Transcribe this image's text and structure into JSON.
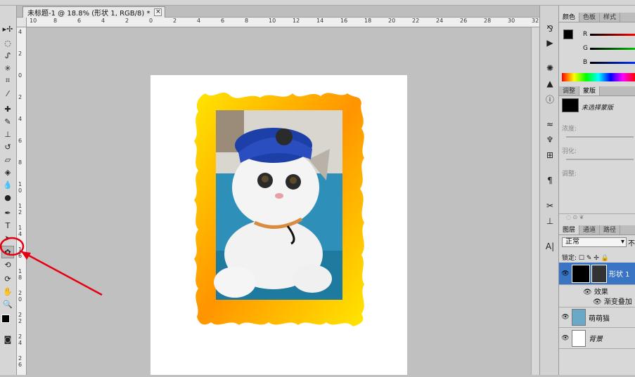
{
  "document": {
    "tab_title": "未标题-1 @ 18.8% (形状 1, RGB/8) *",
    "close_glyph": "×"
  },
  "rulers": {
    "h_ticks": [
      "10",
      "8",
      "6",
      "4",
      "2",
      "0",
      "2",
      "4",
      "6",
      "8",
      "10",
      "12",
      "14",
      "16",
      "18",
      "20",
      "22",
      "24",
      "26",
      "28",
      "30",
      "32"
    ],
    "v_ticks": [
      "4",
      "2",
      "0",
      "2",
      "4",
      "6",
      "8",
      "1 0",
      "1 2",
      "1 4",
      "1 6",
      "1 8",
      "2 0",
      "2 2",
      "2 4",
      "2 6"
    ]
  },
  "tools": [
    {
      "name": "move-tool",
      "glyph": "▸✢"
    },
    {
      "name": "marquee-tool",
      "glyph": "◌"
    },
    {
      "name": "lasso-tool",
      "glyph": "ᔑ"
    },
    {
      "name": "magic-wand-tool",
      "glyph": "✳"
    },
    {
      "name": "crop-tool",
      "glyph": "⌗"
    },
    {
      "name": "eyedropper-tool",
      "glyph": "⁄"
    },
    {
      "name": "healing-brush-tool",
      "glyph": "✚"
    },
    {
      "name": "brush-tool",
      "glyph": "✎"
    },
    {
      "name": "clone-stamp-tool",
      "glyph": "⊥"
    },
    {
      "name": "history-brush-tool",
      "glyph": "↺"
    },
    {
      "name": "eraser-tool",
      "glyph": "▱"
    },
    {
      "name": "paint-bucket-tool",
      "glyph": "◈"
    },
    {
      "name": "blur-tool",
      "glyph": "💧"
    },
    {
      "name": "dodge-tool",
      "glyph": "●"
    },
    {
      "name": "pen-tool",
      "glyph": "✒"
    },
    {
      "name": "type-tool",
      "glyph": "T"
    },
    {
      "name": "path-selection-tool",
      "glyph": "➤"
    },
    {
      "name": "custom-shape-tool",
      "glyph": "✿"
    },
    {
      "name": "3d-rotate-tool",
      "glyph": "⟲"
    },
    {
      "name": "3d-orbit-tool",
      "glyph": "⟳"
    },
    {
      "name": "hand-tool",
      "glyph": "✋"
    },
    {
      "name": "zoom-tool",
      "glyph": "🔍"
    }
  ],
  "color_panel": {
    "tabs": [
      "颜色",
      "色板",
      "样式"
    ],
    "channels": [
      "R",
      "G",
      "B"
    ],
    "foreground": "#000000",
    "background": "#ffffff"
  },
  "masks_panel": {
    "tabs": [
      "调整",
      "蒙版"
    ],
    "no_selection": "未选择蒙版",
    "density_label": "浓度:",
    "feather_label": "羽化:",
    "refine_label": "调整:"
  },
  "layers_panel": {
    "tabs": [
      "图层",
      "通道",
      "路径"
    ],
    "blend_mode": "正常",
    "opacity_label": "不",
    "lock_label": "锁定:",
    "layers": [
      {
        "name": "形状 1",
        "selected": true
      },
      {
        "name": "效果",
        "sub": true
      },
      {
        "name": "渐变叠加",
        "sub": true
      },
      {
        "name": "萌萌猫",
        "selected": false
      },
      {
        "name": "背景",
        "selected": false
      }
    ]
  },
  "colors": {
    "accent_select": "#3a74c4",
    "annotation": "#e60012",
    "frame_gradient_start": "#ffe600",
    "frame_gradient_end": "#ff8a00"
  }
}
